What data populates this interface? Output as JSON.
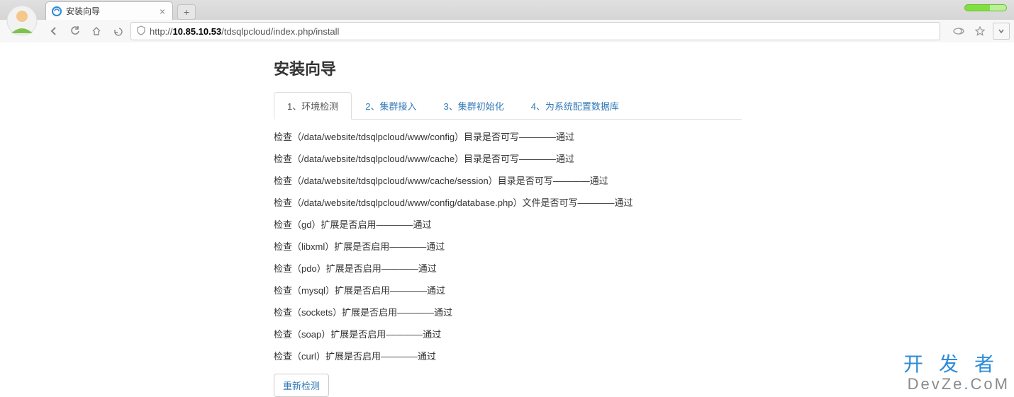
{
  "browser": {
    "tab_title": "安装向导",
    "url_proto": "http://",
    "url_host_bold": "10.85.10.53",
    "url_path": "/tdsqlpcloud/index.php/install"
  },
  "page": {
    "title": "安装向导",
    "tabs": [
      {
        "label": "1、环境检测",
        "active": "true"
      },
      {
        "label": "2、集群接入",
        "active": "false"
      },
      {
        "label": "3、集群初始化",
        "active": "false"
      },
      {
        "label": "4、为系统配置数据库",
        "active": "false"
      }
    ],
    "checks": [
      "检查（/data/website/tdsqlpcloud/www/config）目录是否可写————通过",
      "检查（/data/website/tdsqlpcloud/www/cache）目录是否可写————通过",
      "检查（/data/website/tdsqlpcloud/www/cache/session）目录是否可写————通过",
      "检查（/data/website/tdsqlpcloud/www/config/database.php）文件是否可写————通过",
      "检查（gd）扩展是否启用————通过",
      "检查（libxml）扩展是否启用————通过",
      "检查（pdo）扩展是否启用————通过",
      "检查（mysql）扩展是否启用————通过",
      "检查（sockets）扩展是否启用————通过",
      "检查（soap）扩展是否启用————通过",
      "检查（curl）扩展是否启用————通过"
    ],
    "recheck_label": "重新检测"
  },
  "watermark": {
    "line1": "开发者",
    "line2_a": "DevZe",
    "line2_b": "CoM"
  }
}
